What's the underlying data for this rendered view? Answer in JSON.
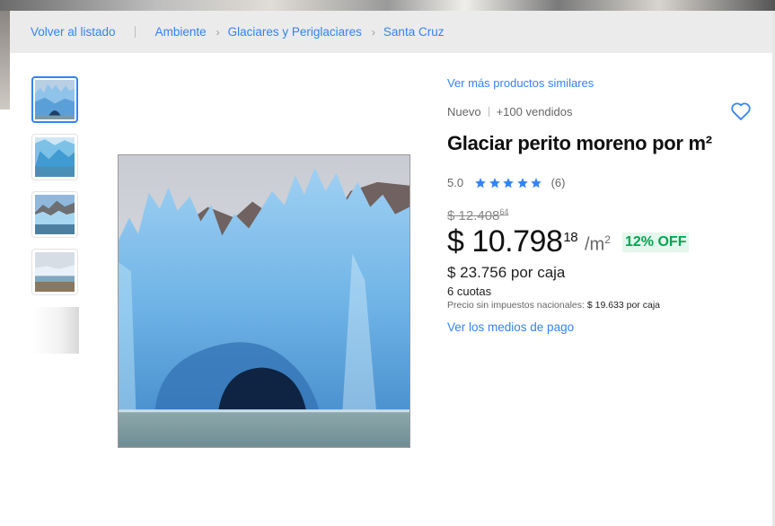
{
  "breadcrumb": {
    "back": "Volver al listado",
    "items": [
      "Ambiente",
      "Glaciares y Periglaciares",
      "Santa Cruz"
    ]
  },
  "product": {
    "similar_link": "Ver más productos similares",
    "condition": "Nuevo",
    "sold": "+100 vendidos",
    "title": "Glaciar perito moreno por m²",
    "rating": "5.0",
    "stars": 5,
    "reviews": "(6)",
    "old_price": "$ 12.408",
    "old_price_cents": "64",
    "price": "$ 10.798",
    "price_cents": "18",
    "unit": "/m",
    "unit_sup": "2",
    "discount": "12% OFF",
    "price_per_box": "$ 23.756 por caja",
    "installments": "6 cuotas",
    "taxless_label": "Precio sin impuestos nacionales:",
    "taxless_value": "$ 19.633 por caja",
    "payment_link": "Ver los medios de pago"
  },
  "colors": {
    "link": "#3483fa",
    "discount": "#00a650",
    "breadcrumb_bg": "#ebebeb"
  },
  "icons": {
    "favorite": "heart-icon",
    "star": "star-icon",
    "breadcrumb_separator": "chevron-right-icon"
  }
}
